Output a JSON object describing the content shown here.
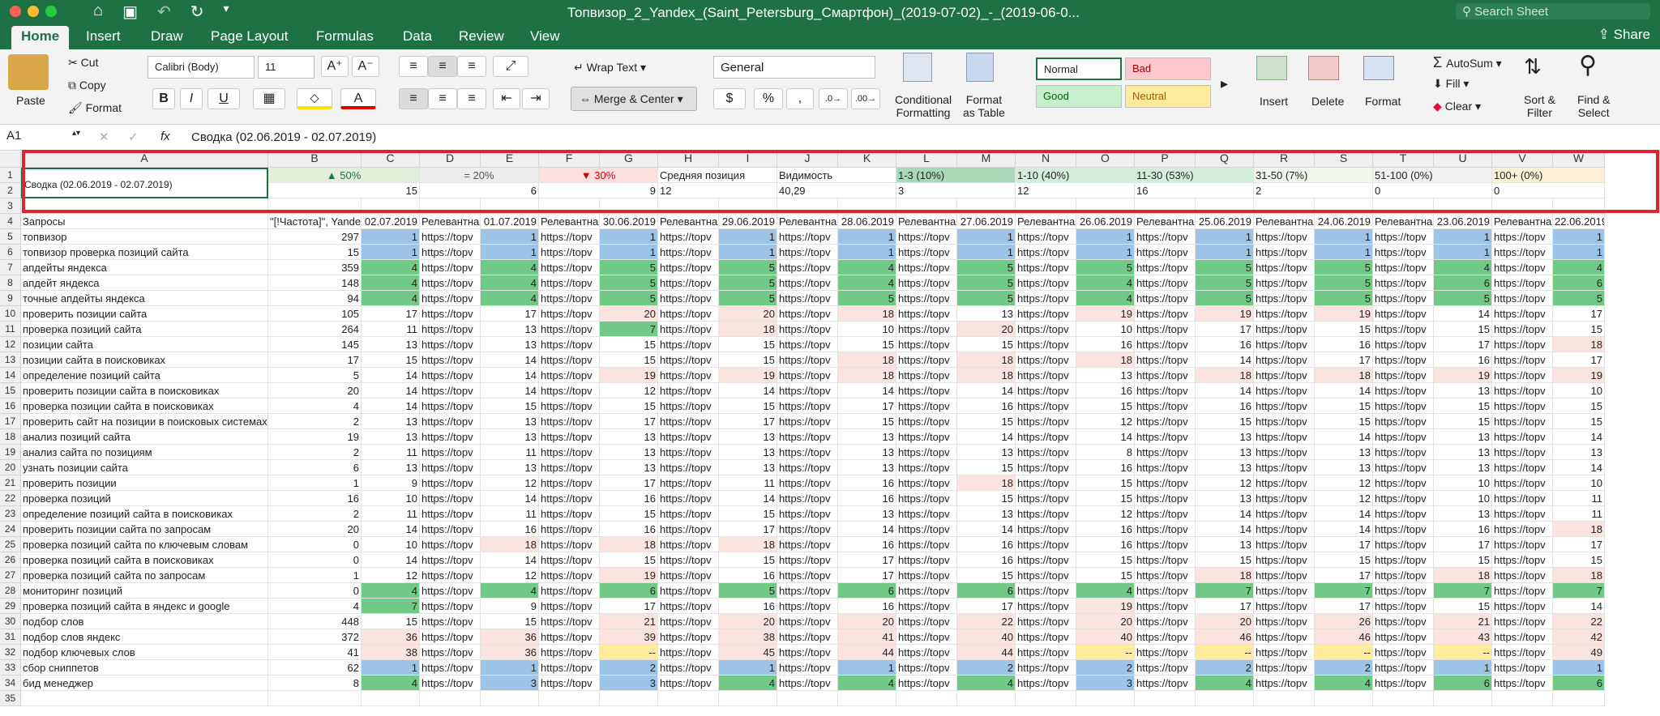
{
  "window": {
    "title": "Топвизор_2_Yandex_(Saint_Petersburg_Смартфон)_(2019-07-02)_-_(2019-06-0...",
    "search_placeholder": "Search Sheet",
    "share": "Share"
  },
  "tabs": [
    "Home",
    "Insert",
    "Draw",
    "Page Layout",
    "Formulas",
    "Data",
    "Review",
    "View"
  ],
  "ribbon": {
    "paste": "Paste",
    "cut": "Cut",
    "copy": "Copy",
    "format": "Format",
    "font": "Calibri (Body)",
    "size": "11",
    "wrap": "Wrap Text",
    "merge": "Merge & Center",
    "numfmt": "General",
    "cond1": "Conditional",
    "cond2": "Formatting",
    "fat1": "Format",
    "fat2": "as Table",
    "styles": {
      "normal": "Normal",
      "bad": "Bad",
      "good": "Good",
      "neutral": "Neutral"
    },
    "insert": "Insert",
    "delete": "Delete",
    "formatc": "Format",
    "autosum": "AutoSum",
    "fill": "Fill",
    "clear": "Clear",
    "sort1": "Sort &",
    "sort2": "Filter",
    "find1": "Find &",
    "find2": "Select"
  },
  "formula": {
    "ref": "A1",
    "fx": "fx",
    "value": "Сводка (02.06.2019 - 02.07.2019)"
  },
  "colors": {
    "blue": "#9dc3e6",
    "green": "#70c985",
    "lgreen": "#c6efce",
    "red": "#f4c7c3",
    "yellow": "#ffeb9c"
  },
  "columns": [
    "A",
    "B",
    "C",
    "D",
    "E",
    "F",
    "G",
    "H",
    "I",
    "J",
    "K",
    "L",
    "M",
    "N",
    "O",
    "P",
    "Q",
    "R",
    "S",
    "T",
    "U",
    "V",
    "W"
  ],
  "rows": [
    "1",
    "2",
    "3",
    "4",
    "5",
    "6",
    "7",
    "8",
    "9",
    "10",
    "11",
    "12",
    "13",
    "14",
    "15",
    "16",
    "17",
    "18",
    "19",
    "20",
    "21",
    "22",
    "23",
    "24",
    "25",
    "26",
    "27",
    "28",
    "29",
    "30",
    "31",
    "32",
    "33",
    "34",
    "35"
  ],
  "summary": {
    "a1": "Сводка (02.06.2019 - 02.07.2019)",
    "up": "▲ 50%",
    "eq": "= 20%",
    "down": "▼ 30%",
    "avg": "Средняя позиция",
    "vis": "Видимость",
    "r13": "1-3 (10%)",
    "r110": "1-10 (40%)",
    "r1130": "11-30 (53%)",
    "r3150": "31-50 (7%)",
    "r51100": "51-100 (0%)",
    "r100": "100+ (0%)",
    "v_up": "15",
    "v_eq": "6",
    "v_down": "9",
    "v_avg": "12",
    "v_vis": "40,29",
    "v_13": "3",
    "v_110": "12",
    "v_1130": "16",
    "v_3150": "2",
    "v_51100": "0",
    "v_100": "0"
  },
  "header4": [
    "Запросы",
    "\"[!Частота]\", Yandex",
    "02.07.2019",
    "Релевантная",
    "01.07.2019",
    "Релевантная",
    "30.06.2019",
    "Релевантная",
    "29.06.2019",
    "Релевантная",
    "28.06.2019",
    "Релевантная",
    "27.06.2019",
    "Релевантная",
    "26.06.2019",
    "Релевантная",
    "25.06.2019",
    "Релевантная",
    "24.06.2019",
    "Релевантная",
    "23.06.2019",
    "Релевантная",
    "22.06.2019"
  ],
  "url": "https://topv",
  "data": [
    [
      "топвизор",
      "297",
      [
        "1",
        "1",
        "1",
        "1",
        "1",
        "1",
        "1",
        "1",
        "1",
        "1",
        "1"
      ]
    ],
    [
      "топвизор проверка позиций сайта",
      "15",
      [
        "1",
        "1",
        "1",
        "1",
        "1",
        "1",
        "1",
        "1",
        "1",
        "1",
        "1"
      ]
    ],
    [
      "апдейты яндекса",
      "359",
      [
        "4",
        "4",
        "5",
        "5",
        "4",
        "5",
        "5",
        "5",
        "5",
        "4",
        "4"
      ]
    ],
    [
      "апдейт яндекса",
      "148",
      [
        "4",
        "4",
        "5",
        "5",
        "4",
        "5",
        "4",
        "5",
        "5",
        "6",
        "6"
      ]
    ],
    [
      "точные апдейты яндекса",
      "94",
      [
        "4",
        "4",
        "5",
        "5",
        "5",
        "5",
        "4",
        "5",
        "5",
        "5",
        "5"
      ]
    ],
    [
      "проверить позиции сайта",
      "105",
      [
        "17",
        "17",
        "20",
        "20",
        "18",
        "13",
        "19",
        "19",
        "19",
        "14",
        "17"
      ]
    ],
    [
      "проверка позиций сайта",
      "264",
      [
        "11",
        "13",
        "7",
        "18",
        "10",
        "20",
        "10",
        "17",
        "15",
        "15",
        "15"
      ]
    ],
    [
      "позиции сайта",
      "145",
      [
        "13",
        "13",
        "15",
        "15",
        "15",
        "15",
        "16",
        "16",
        "16",
        "17",
        "18"
      ]
    ],
    [
      "позиции сайта в поисковиках",
      "17",
      "[\"15\",\"14\",\"15\",\"15\",\"18\",\"18\",\"18\",\"14\",\"17\",\"16\",\"17\"]"
    ],
    [
      "определение позиций сайта",
      "5",
      [
        "14",
        "14",
        "19",
        "19",
        "18",
        "18",
        "13",
        "18",
        "18",
        "19",
        "19"
      ]
    ],
    [
      "проверить позиции сайта в поисковиках",
      "20",
      [
        "14",
        "14",
        "12",
        "14",
        "14",
        "14",
        "16",
        "14",
        "14",
        "13",
        "10"
      ]
    ],
    [
      "проверка позиции сайта в поисковиках",
      "4",
      [
        "14",
        "15",
        "15",
        "15",
        "17",
        "16",
        "15",
        "16",
        "15",
        "15",
        "15"
      ]
    ],
    [
      "проверить сайт на позиции в поисковых системах",
      "2",
      [
        "13",
        "13",
        "17",
        "17",
        "15",
        "15",
        "12",
        "15",
        "15",
        "15",
        "15"
      ]
    ],
    [
      "анализ позиций сайта",
      "19",
      [
        "13",
        "13",
        "13",
        "13",
        "13",
        "14",
        "14",
        "13",
        "14",
        "13",
        "14"
      ]
    ],
    [
      "анализ сайта по позициям",
      "2",
      [
        "11",
        "11",
        "13",
        "13",
        "13",
        "13",
        "8",
        "13",
        "13",
        "13",
        "13"
      ]
    ],
    [
      "узнать позиции сайта",
      "6",
      [
        "13",
        "13",
        "13",
        "13",
        "13",
        "15",
        "16",
        "13",
        "13",
        "13",
        "14"
      ]
    ],
    [
      "проверить позиции",
      "1",
      [
        "9",
        "12",
        "17",
        "11",
        "16",
        "18",
        "15",
        "12",
        "12",
        "10",
        "10"
      ]
    ],
    [
      "проверка позиций",
      "16",
      [
        "10",
        "14",
        "16",
        "14",
        "16",
        "15",
        "15",
        "13",
        "12",
        "10",
        "11"
      ]
    ],
    [
      "определение позиций сайта в поисковиках",
      "2",
      [
        "11",
        "11",
        "15",
        "15",
        "13",
        "13",
        "12",
        "14",
        "14",
        "13",
        "11"
      ]
    ],
    [
      "проверить позиции сайта по запросам",
      "20",
      [
        "14",
        "16",
        "16",
        "17",
        "14",
        "14",
        "16",
        "14",
        "14",
        "16",
        "18"
      ]
    ],
    [
      "проверка позиций сайта по ключевым словам",
      "0",
      [
        "10",
        "18",
        "18",
        "18",
        "16",
        "16",
        "16",
        "13",
        "17",
        "17",
        "17"
      ]
    ],
    [
      "проверка позиций сайта в поисковиках",
      "0",
      [
        "14",
        "14",
        "15",
        "15",
        "17",
        "16",
        "15",
        "15",
        "15",
        "15",
        "15"
      ]
    ],
    [
      "проверка позиций сайта по запросам",
      "1",
      [
        "12",
        "12",
        "19",
        "16",
        "17",
        "15",
        "15",
        "18",
        "17",
        "18",
        "18"
      ]
    ],
    [
      "мониторинг позиций",
      "0",
      [
        "4",
        "4",
        "6",
        "5",
        "6",
        "6",
        "4",
        "7",
        "7",
        "7",
        "7"
      ]
    ],
    [
      "проверка позиций сайта в яндекс и google",
      "4",
      [
        "7",
        "9",
        "17",
        "16",
        "16",
        "17",
        "19",
        "17",
        "17",
        "15",
        "14"
      ]
    ],
    [
      "подбор слов",
      "448",
      [
        "15",
        "15",
        "21",
        "20",
        "20",
        "22",
        "20",
        "20",
        "26",
        "21",
        "22"
      ]
    ],
    [
      "подбор слов яндекс",
      "372",
      [
        "36",
        "36",
        "39",
        "38",
        "41",
        "40",
        "40",
        "46",
        "46",
        "43",
        "42"
      ]
    ],
    [
      "подбор ключевых слов",
      "41",
      [
        "38",
        "36",
        "--",
        "45",
        "44",
        "44",
        "--",
        "--",
        "--",
        "--",
        "49"
      ]
    ],
    [
      "сбор сниппетов",
      "62",
      [
        "1",
        "1",
        "2",
        "1",
        "1",
        "2",
        "2",
        "2",
        "2",
        "1",
        "1"
      ]
    ],
    [
      "бид менеджер",
      "8",
      [
        "4",
        "3",
        "3",
        "4",
        "4",
        "4",
        "3",
        "4",
        "4",
        "6",
        "6"
      ]
    ]
  ]
}
